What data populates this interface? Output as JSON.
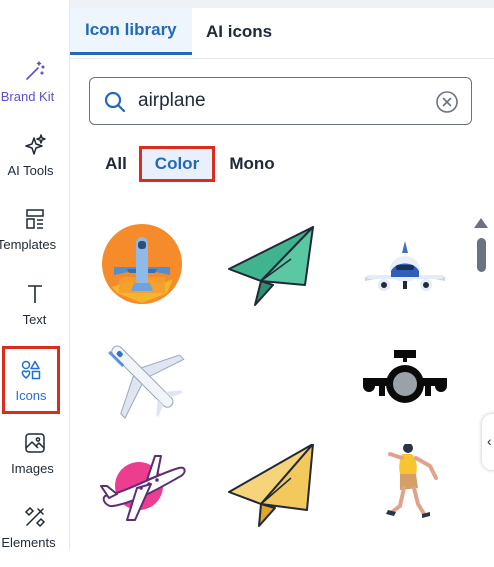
{
  "rail": {
    "items": [
      {
        "label": "Brand Kit",
        "icon": "magic-wand-icon"
      },
      {
        "label": "AI Tools",
        "icon": "sparkles-icon"
      },
      {
        "label": "Templates",
        "icon": "templates-icon"
      },
      {
        "label": "Text",
        "icon": "text-icon"
      },
      {
        "label": "Icons",
        "icon": "shapes-icon"
      },
      {
        "label": "Images",
        "icon": "image-icon"
      },
      {
        "label": "Elements",
        "icon": "elements-icon"
      }
    ],
    "active_index": 4
  },
  "tabs": [
    {
      "label": "Icon library",
      "active": true
    },
    {
      "label": "AI icons",
      "active": false
    }
  ],
  "search": {
    "value": "airplane",
    "icon": "search-icon",
    "clear_icon": "clear-icon"
  },
  "filters": [
    {
      "label": "All",
      "active": false
    },
    {
      "label": "Color",
      "active": true
    },
    {
      "label": "Mono",
      "active": false
    }
  ],
  "results": [
    {
      "icon": "airplane-badge-icon"
    },
    {
      "icon": "paper-plane-green-icon"
    },
    {
      "icon": "airplane-front-view-icon"
    },
    {
      "icon": "airplane-diagonal-icon"
    },
    {
      "icon": "empty-slot"
    },
    {
      "icon": "airplane-silhouette-icon"
    },
    {
      "icon": "pink-airplane-icon"
    },
    {
      "icon": "paper-plane-yellow-icon"
    },
    {
      "icon": "running-person-icon"
    }
  ],
  "colors": {
    "accent": "#2469b8",
    "highlight": "#d92d20",
    "brand": "#5a4fcf"
  }
}
